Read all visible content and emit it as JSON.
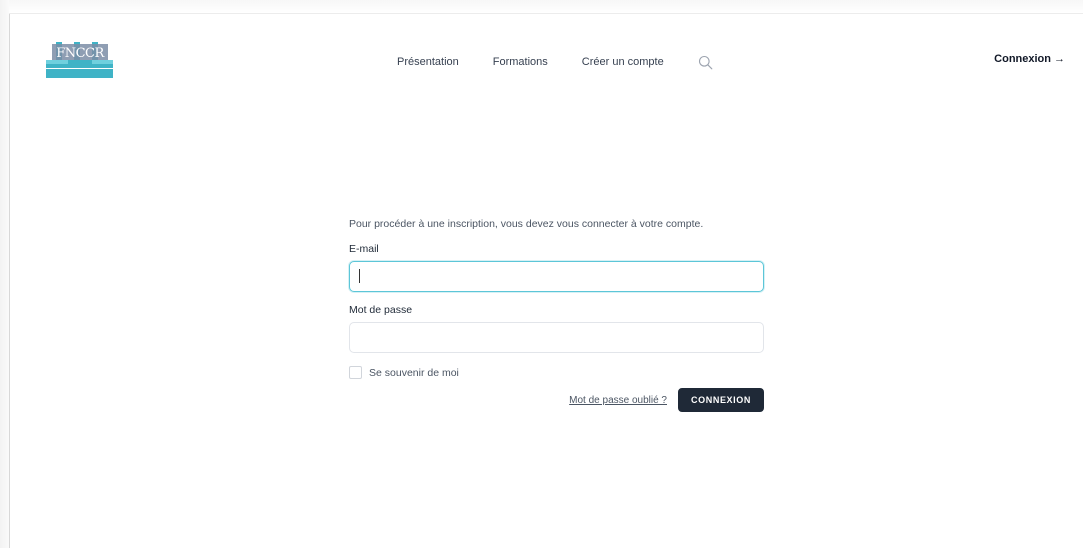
{
  "logo": {
    "text": "FNCCR"
  },
  "nav": {
    "items": [
      {
        "label": "Présentation"
      },
      {
        "label": "Formations"
      },
      {
        "label": "Créer un compte"
      }
    ],
    "login_label": "Connexion",
    "login_arrow": "→"
  },
  "form": {
    "intro": "Pour procéder à une inscription, vous devez vous connecter à votre compte.",
    "email_label": "E-mail",
    "email_value": "",
    "password_label": "Mot de passe",
    "password_value": "",
    "remember_label": "Se souvenir de moi",
    "forgot_label": "Mot de passe oublié ?",
    "submit_label": "CONNEXION"
  },
  "colors": {
    "accent": "#5cc6d8",
    "logo_teal": "#3fb3c6",
    "logo_dark": "#6b7e98",
    "button": "#1f2937"
  },
  "icons": {
    "search": "search-icon"
  }
}
